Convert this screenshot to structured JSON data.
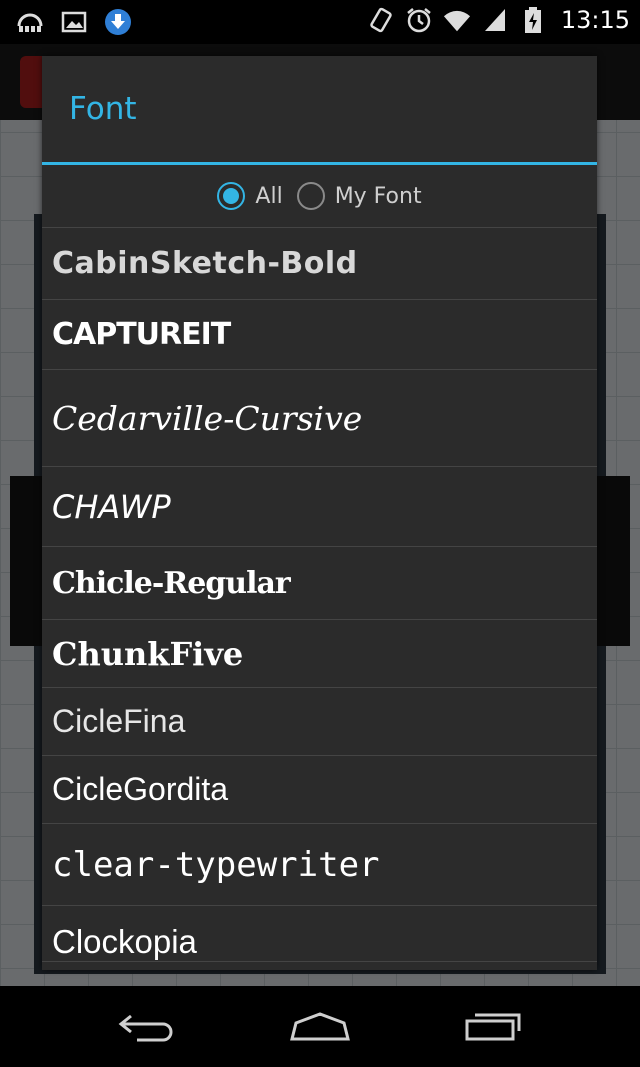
{
  "status_bar": {
    "time": "13:15",
    "left_icons": [
      "sync-icon",
      "image-icon",
      "download-icon"
    ],
    "right_icons": [
      "vibrate-icon",
      "alarm-icon",
      "wifi-icon",
      "signal-icon",
      "battery-charging-icon"
    ]
  },
  "dialog": {
    "title": "Font",
    "accent_color": "#33b5e5",
    "filter": {
      "options": [
        "All",
        "My Font"
      ],
      "selected": "All"
    },
    "fonts": [
      "CabinSketch-Bold",
      "CAPTUREIT",
      "Cedarville-Cursive",
      "CHAWP",
      "Chicle-Regular",
      "ChunkFive",
      "CicleFina",
      "CicleGordita",
      "clear-typewriter",
      "Clockopia"
    ]
  },
  "nav_bar": {
    "buttons": [
      "back-icon",
      "home-icon",
      "recents-icon"
    ]
  }
}
